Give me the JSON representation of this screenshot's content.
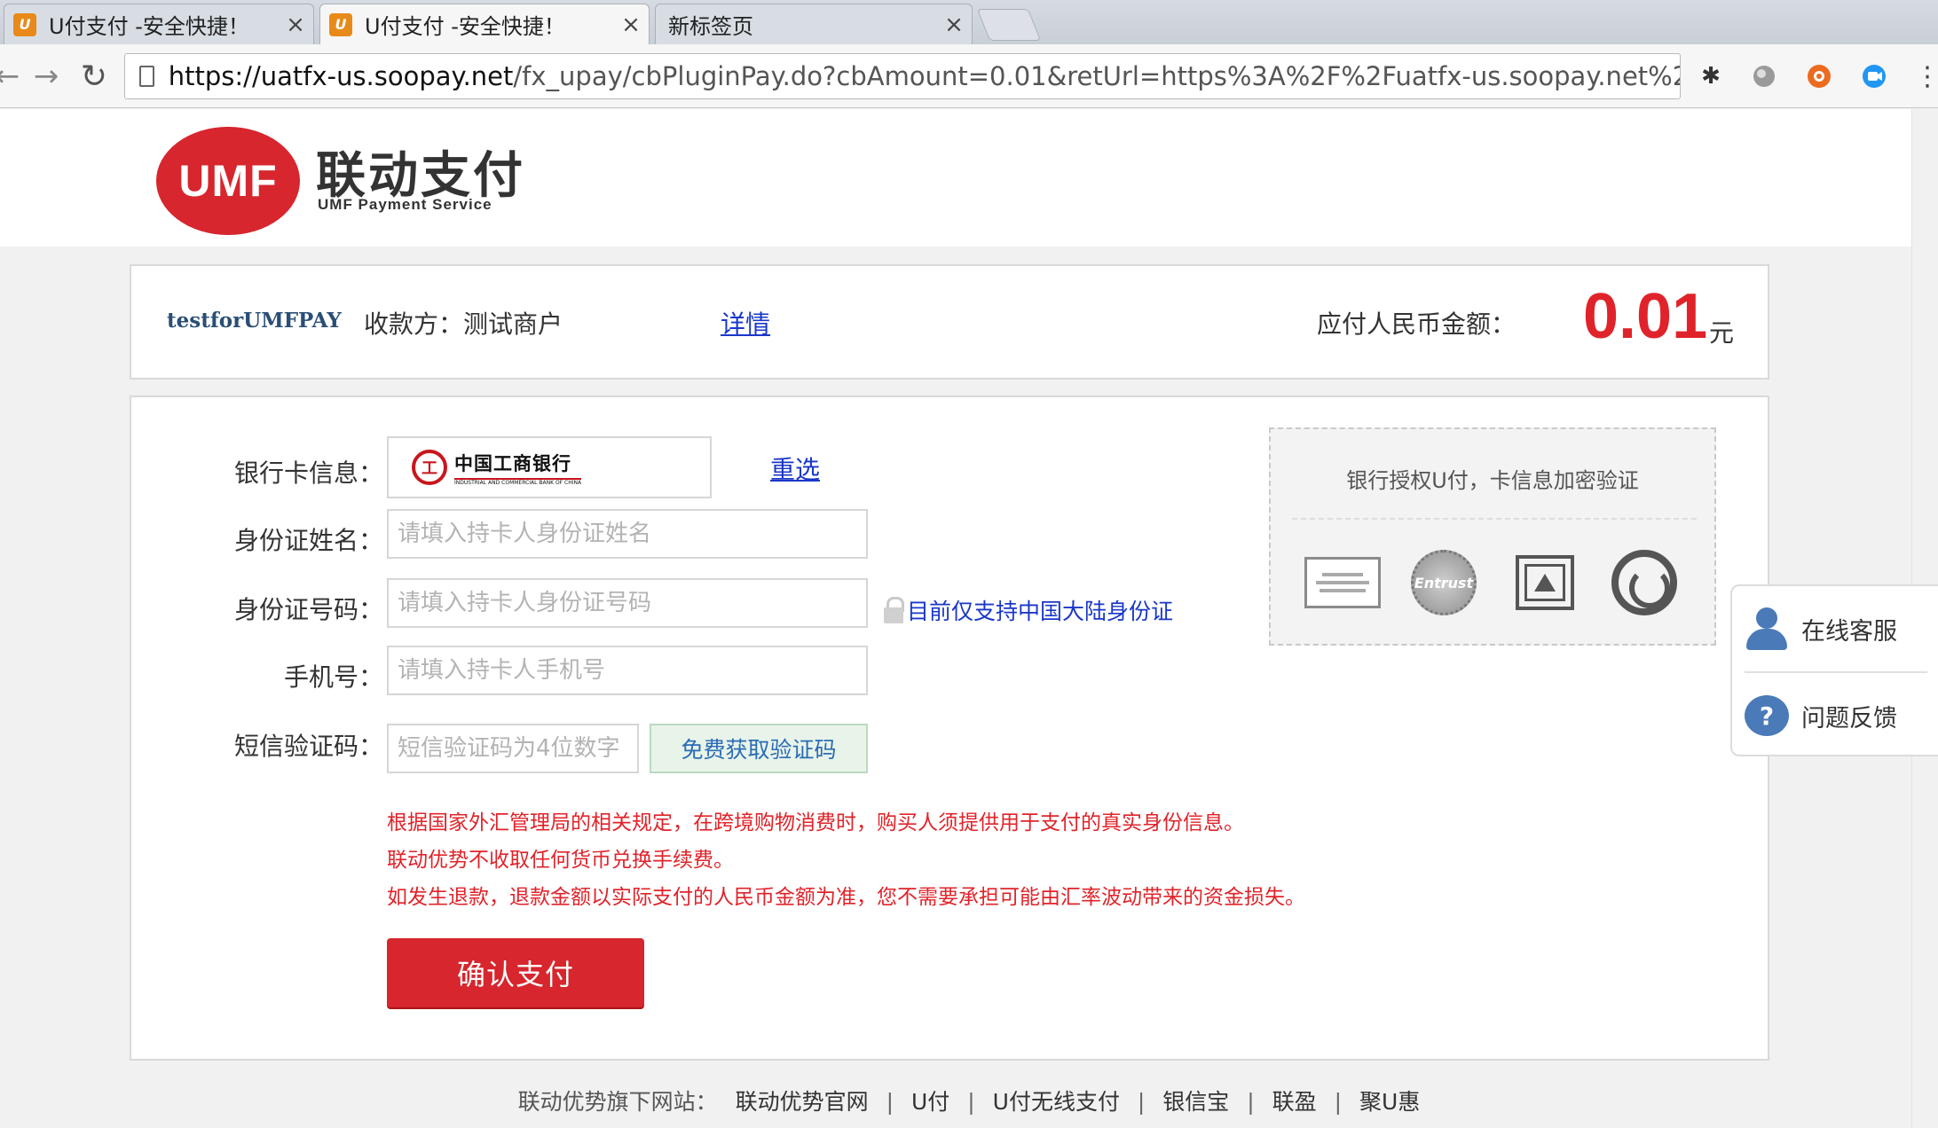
{
  "browser": {
    "tabs": [
      {
        "label": "U付支付 -安全快捷！",
        "favicon": "U"
      },
      {
        "label": "U付支付 -安全快捷！",
        "favicon": "U"
      },
      {
        "label": "新标签页"
      }
    ],
    "tab_close_glyph": "×",
    "url_host": "https://uatfx-us.soopay.net",
    "url_path": "/fx_upay/cbPluginPay.do?cbAmount=0.01&retUrl=https%3A%2F%2Fuatfx-us.soopay.net%2Ffx_upay...",
    "extension_icons": [
      "spider-extension-icon",
      "globe-extension-icon",
      "orange-extension-icon",
      "blue-extension-icon"
    ]
  },
  "header": {
    "logo_mark": "UMF",
    "logo_title": "联动支付",
    "logo_subtitle": "UMF Payment Service"
  },
  "order": {
    "merchant_id": "testforUMFPAY",
    "payee": "收款方：测试商户",
    "detail_link": "详情",
    "amount_label": "应付人民币金额：",
    "amount_value": "0.01",
    "amount_unit": "元"
  },
  "form": {
    "bank_label": "银行卡信息：",
    "bank_name": "中国工商银行",
    "bank_name_en": "INDUSTRIAL AND COMMERCIAL BANK OF CHINA",
    "reselect": "重选",
    "name_label": "身份证姓名：",
    "name_placeholder": "请填入持卡人身份证姓名",
    "id_label": "身份证号码：",
    "id_placeholder": "请填入持卡人身份证号码",
    "id_note": "目前仅支持中国大陆身份证",
    "phone_label": "手机号：",
    "phone_placeholder": "请填入持卡人手机号",
    "sms_label": "短信验证码：",
    "sms_placeholder": "短信验证码为4位数字",
    "sms_button": "免费获取验证码",
    "notices": [
      "根据国家外汇管理局的相关规定，在跨境购物消费时，购买人须提供用于支付的真实身份信息。",
      "联动优势不收取任何货币兑换手续费。",
      "如发生退款，退款金额以实际支付的人民币金额为准，您不需要承担可能由汇率波动带来的资金损失。"
    ],
    "confirm_button": "确认支付"
  },
  "security": {
    "title": "银行授权U付，卡信息加密验证",
    "seal_text": "Entrust"
  },
  "float_service": {
    "online_service": "在线客服",
    "feedback": "问题反馈"
  },
  "footer": {
    "label": "联动优势旗下网站：",
    "links": [
      "联动优势官网",
      "U付",
      "U付无线支付",
      "银信宝",
      "联盈",
      "聚U惠"
    ],
    "separator": "|"
  },
  "colors": {
    "brand_red": "#d7262d",
    "amount_red": "#e0232a",
    "link_blue": "#1a37c8",
    "notice_red": "#e0232a"
  }
}
